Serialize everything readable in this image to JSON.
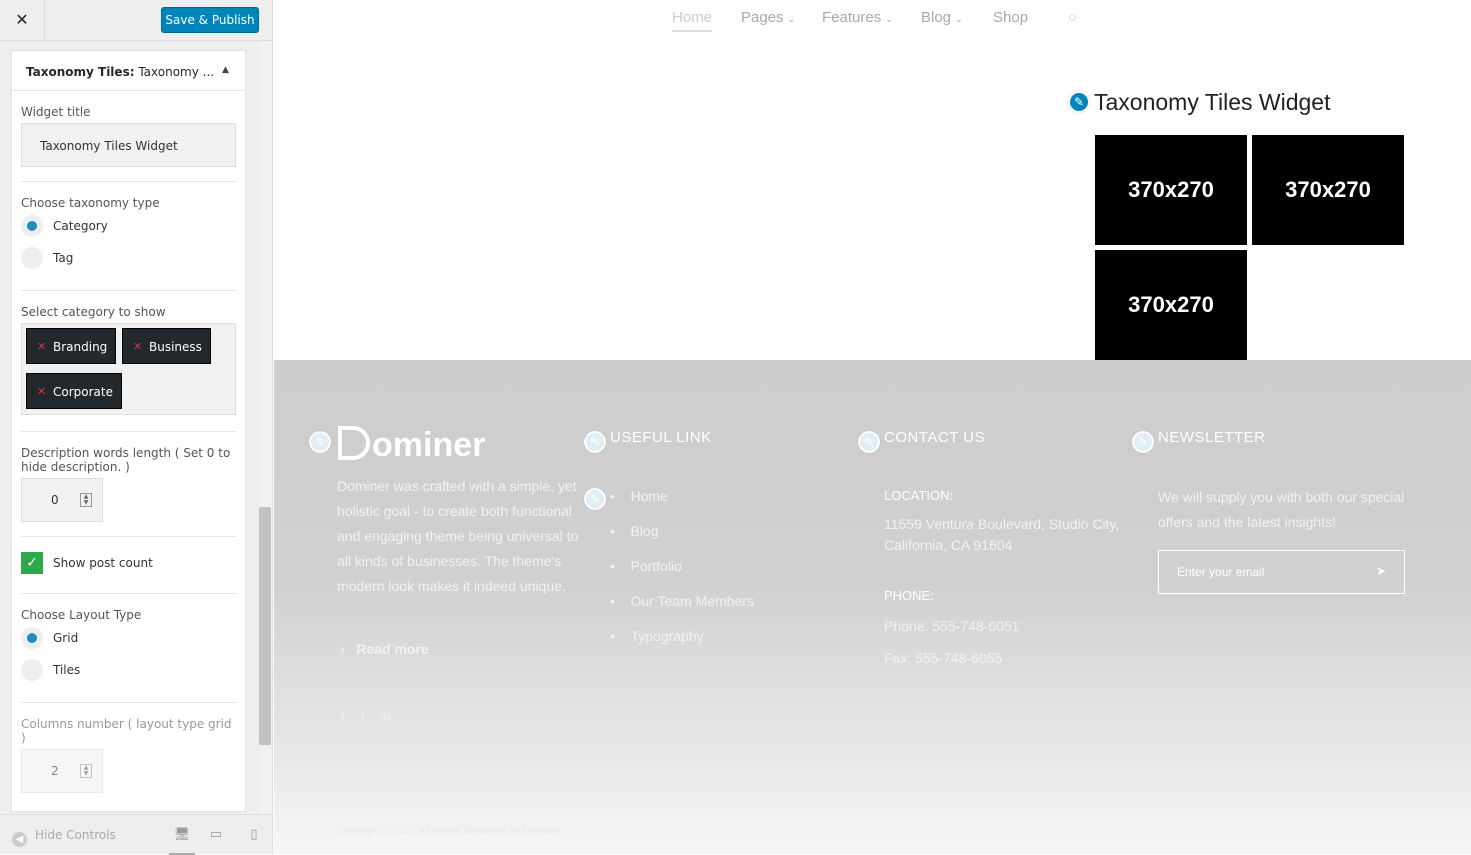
{
  "customizer": {
    "close_label": "✕",
    "save_label": "Save & Publish",
    "widget_header": {
      "prefix": "Taxonomy Tiles:",
      "suffix": " Taxonomy ..."
    },
    "widget_title": {
      "label": "Widget title",
      "value": "Taxonomy Tiles Widget"
    },
    "taxonomy_type": {
      "label": "Choose taxonomy type",
      "options": [
        "Category",
        "Tag"
      ],
      "selected": "Category"
    },
    "categories": {
      "label": "Select category to show",
      "tags": [
        "Branding",
        "Business",
        "Corporate"
      ]
    },
    "desc_length": {
      "label": "Description words length ( Set 0 to hide description. )",
      "value": "0"
    },
    "post_count": {
      "label": "Show post count",
      "checked": true
    },
    "layout_type": {
      "label": "Choose Layout Type",
      "options": [
        "Grid",
        "Tiles"
      ],
      "selected": "Grid"
    },
    "columns": {
      "label": "Columns number ( layout type grid )",
      "value": "2"
    },
    "footer": {
      "hide_label": "Hide Controls"
    }
  },
  "preview": {
    "nav": [
      "Home",
      "Pages",
      "Features",
      "Blog",
      "Shop"
    ],
    "widget_title": "Taxonomy Tiles Widget",
    "tiles": [
      "370x270",
      "370x270",
      "370x270"
    ],
    "footer": {
      "logo": "ominer",
      "about": "Dominer was crafted with a simple, yet holistic goal - to create both functional and engaging theme being universal to all kinds of businesses. The theme's modern look makes it indeed unique.",
      "read_more": "Read more",
      "useful_title": "USEFUL LINK",
      "links": [
        "Home",
        "Blog",
        "Portfolio",
        "Our Team Members",
        "Typography"
      ],
      "contact_title": "CONTACT US",
      "location_label": "LOCATION:",
      "location_value": "11559 Ventura Boulevard, Studio City, California, CA 91604",
      "phone_label": "PHONE:",
      "phone": "Phone: 555-748-6051",
      "fax": "Fax: 555-748-6055",
      "newsletter_title": "NEWSLETTER",
      "newsletter_text": "We will supply you with both our special offers and the latest insights!",
      "email_placeholder": "Enter your email",
      "copyright": "Copyright © 2017 All Rights Reserved by Dominer"
    }
  }
}
